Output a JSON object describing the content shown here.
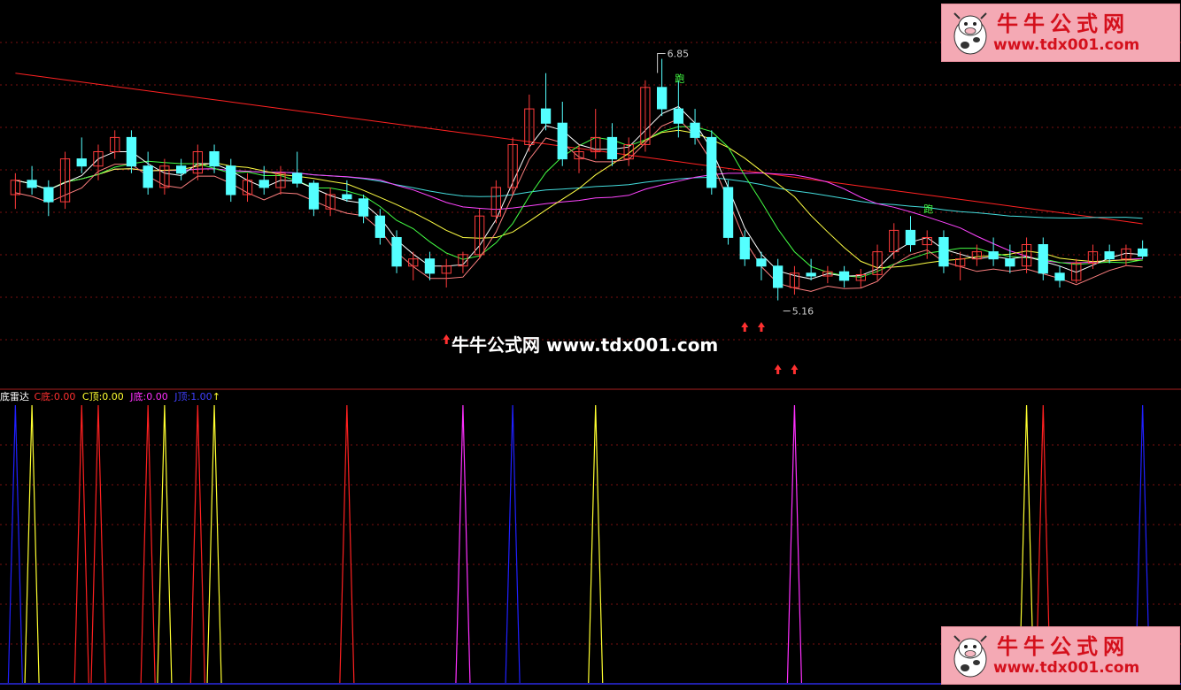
{
  "colors": {
    "bg": "#000000",
    "grid": "#7a1010",
    "candle_up": "#ff3b3b",
    "candle_down": "#54ffff",
    "ma5": "#ffffff",
    "ma10": "#ffff44",
    "ma20": "#ff44ff",
    "ma30": "#44ff44",
    "ma60": "#44dddd",
    "ma120": "#ff2222",
    "channel": "#ff8080",
    "c_bottom": "#ff2020",
    "c_top": "#ffff30",
    "j_bottom": "#ff30ff",
    "j_top": "#2020ff"
  },
  "price_axis": {
    "min": 4.6,
    "max": 7.2
  },
  "annotations": {
    "high_label": "6.85",
    "low_label": "5.16",
    "run_signal_1": "跑",
    "run_signal_2": "跑"
  },
  "watermark": {
    "center_text": "牛牛公式网 www.tdx001.com",
    "box_title": "牛牛公式网",
    "box_url": "www.tdx001.com",
    "icon": "cow-mascot-icon"
  },
  "indicator": {
    "name": "底雷达",
    "c_bottom_label": "C底:",
    "c_bottom_value": "0.00",
    "c_top_label": "C顶:",
    "c_top_value": "0.00",
    "j_bottom_label": "J底:",
    "j_bottom_value": "0.00",
    "j_top_label": "J顶:",
    "j_top_value": "1.00",
    "arrow": "↑"
  },
  "chart_data": [
    {
      "type": "candlestick",
      "title": "",
      "ylim": [
        4.6,
        7.2
      ],
      "grid": true,
      "candles": [
        [
          5.9,
          6.05,
          5.8,
          6.0
        ],
        [
          6.0,
          6.1,
          5.9,
          5.95
        ],
        [
          5.95,
          6.0,
          5.75,
          5.85
        ],
        [
          5.85,
          6.2,
          5.8,
          6.15
        ],
        [
          6.15,
          6.3,
          6.05,
          6.1
        ],
        [
          6.1,
          6.25,
          6.0,
          6.2
        ],
        [
          6.2,
          6.35,
          6.15,
          6.3
        ],
        [
          6.3,
          6.35,
          6.05,
          6.1
        ],
        [
          6.1,
          6.2,
          5.9,
          5.95
        ],
        [
          5.95,
          6.15,
          5.9,
          6.1
        ],
        [
          6.1,
          6.15,
          6.0,
          6.05
        ],
        [
          6.05,
          6.25,
          6.0,
          6.2
        ],
        [
          6.2,
          6.25,
          6.05,
          6.1
        ],
        [
          6.1,
          6.15,
          5.85,
          5.9
        ],
        [
          5.9,
          6.05,
          5.85,
          6.0
        ],
        [
          6.0,
          6.1,
          5.9,
          5.95
        ],
        [
          5.95,
          6.1,
          5.9,
          6.05
        ],
        [
          6.05,
          6.2,
          5.95,
          5.98
        ],
        [
          5.98,
          6.0,
          5.75,
          5.8
        ],
        [
          5.8,
          5.95,
          5.75,
          5.9
        ],
        [
          5.9,
          6.0,
          5.85,
          5.87
        ],
        [
          5.87,
          5.9,
          5.7,
          5.75
        ],
        [
          5.75,
          5.8,
          5.55,
          5.6
        ],
        [
          5.6,
          5.65,
          5.35,
          5.4
        ],
        [
          5.4,
          5.5,
          5.3,
          5.45
        ],
        [
          5.45,
          5.5,
          5.3,
          5.35
        ],
        [
          5.35,
          5.45,
          5.25,
          5.4
        ],
        [
          5.4,
          5.5,
          5.35,
          5.48
        ],
        [
          5.48,
          5.8,
          5.45,
          5.75
        ],
        [
          5.75,
          6.0,
          5.7,
          5.95
        ],
        [
          5.95,
          6.3,
          5.9,
          6.25
        ],
        [
          6.25,
          6.6,
          6.2,
          6.5
        ],
        [
          6.5,
          6.75,
          6.35,
          6.4
        ],
        [
          6.4,
          6.55,
          6.1,
          6.15
        ],
        [
          6.15,
          6.25,
          6.05,
          6.2
        ],
        [
          6.2,
          6.5,
          6.15,
          6.3
        ],
        [
          6.3,
          6.4,
          6.1,
          6.15
        ],
        [
          6.15,
          6.3,
          6.1,
          6.25
        ],
        [
          6.25,
          6.7,
          6.2,
          6.65
        ],
        [
          6.65,
          6.85,
          6.45,
          6.5
        ],
        [
          6.5,
          6.7,
          6.3,
          6.4
        ],
        [
          6.4,
          6.5,
          6.25,
          6.3
        ],
        [
          6.3,
          6.35,
          5.9,
          5.95
        ],
        [
          5.95,
          6.0,
          5.55,
          5.6
        ],
        [
          5.6,
          5.65,
          5.4,
          5.45
        ],
        [
          5.45,
          5.5,
          5.3,
          5.4
        ],
        [
          5.4,
          5.45,
          5.16,
          5.25
        ],
        [
          5.25,
          5.4,
          5.2,
          5.35
        ],
        [
          5.35,
          5.45,
          5.3,
          5.33
        ],
        [
          5.33,
          5.4,
          5.28,
          5.36
        ],
        [
          5.36,
          5.4,
          5.25,
          5.3
        ],
        [
          5.3,
          5.38,
          5.25,
          5.34
        ],
        [
          5.34,
          5.55,
          5.3,
          5.5
        ],
        [
          5.5,
          5.7,
          5.45,
          5.65
        ],
        [
          5.65,
          5.75,
          5.5,
          5.55
        ],
        [
          5.55,
          5.65,
          5.45,
          5.6
        ],
        [
          5.6,
          5.65,
          5.35,
          5.4
        ],
        [
          5.4,
          5.5,
          5.3,
          5.45
        ],
        [
          5.45,
          5.55,
          5.4,
          5.5
        ],
        [
          5.5,
          5.6,
          5.4,
          5.45
        ],
        [
          5.45,
          5.55,
          5.35,
          5.4
        ],
        [
          5.4,
          5.6,
          5.35,
          5.55
        ],
        [
          5.55,
          5.6,
          5.3,
          5.35
        ],
        [
          5.35,
          5.4,
          5.25,
          5.3
        ],
        [
          5.3,
          5.45,
          5.28,
          5.42
        ],
        [
          5.42,
          5.55,
          5.38,
          5.5
        ],
        [
          5.5,
          5.55,
          5.42,
          5.45
        ],
        [
          5.45,
          5.55,
          5.4,
          5.52
        ],
        [
          5.52,
          5.58,
          5.45,
          5.47
        ]
      ]
    },
    {
      "type": "line",
      "title": "",
      "series": [
        {
          "name": "C底",
          "spikes": [
            4,
            5,
            8,
            11,
            20,
            62
          ]
        },
        {
          "name": "C顶",
          "spikes": [
            1,
            9,
            12,
            35,
            61
          ]
        },
        {
          "name": "J底",
          "spikes": [
            27,
            47
          ]
        },
        {
          "name": "J顶",
          "spikes": [
            0,
            30,
            68
          ]
        }
      ]
    }
  ]
}
